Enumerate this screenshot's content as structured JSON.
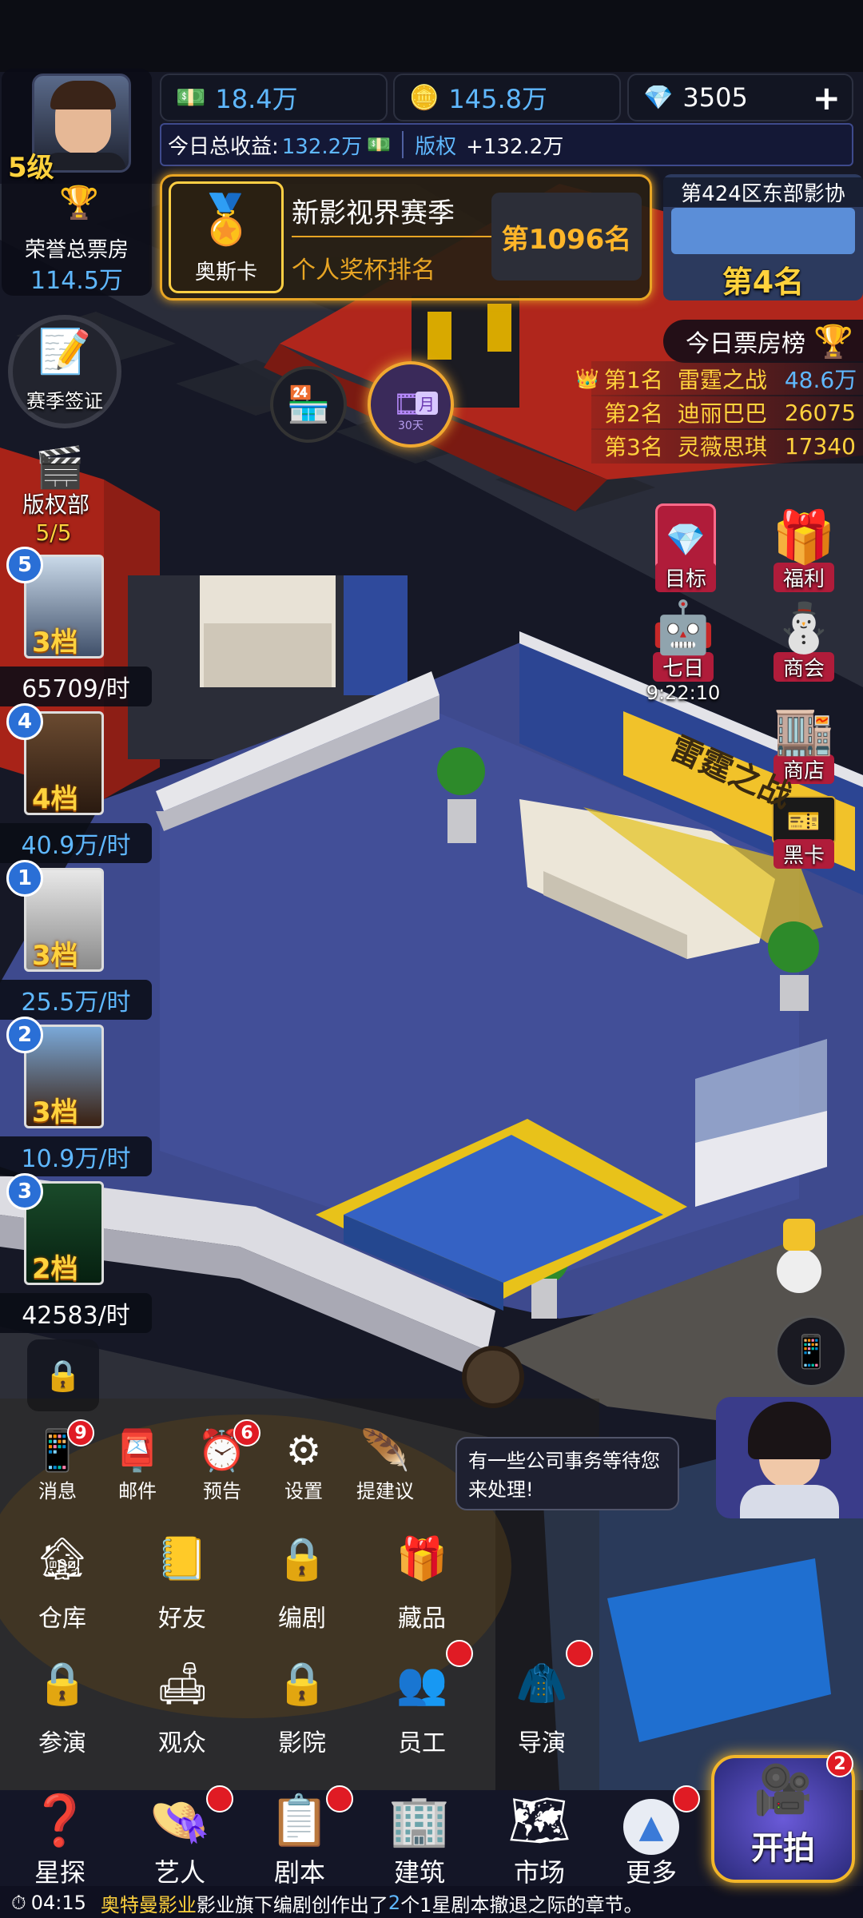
{
  "currency": {
    "cash": "18.4万",
    "gold": "145.8万",
    "diamonds": "3505",
    "plus": "+",
    "today_label": "今日总收益:",
    "today_value": "132.2万",
    "copyright_label": "版权",
    "copyright_value": "+132.2万"
  },
  "player": {
    "level": "5级",
    "honor_label": "荣誉总票房",
    "honor_value": "114.5万"
  },
  "season": {
    "card_label": "奥斯卡",
    "title": "新影视界赛季",
    "subtitle": "个人奖杯排名",
    "rank": "第1096名"
  },
  "region": {
    "name": "第424区东部影协",
    "rank": "第4名"
  },
  "boxoffice": {
    "title": "今日票房榜",
    "rows": [
      {
        "rank": "第1名",
        "name": "雷霆之战",
        "value": "48.6万"
      },
      {
        "rank": "第2名",
        "name": "迪丽巴巴",
        "value": "26075"
      },
      {
        "rank": "第3名",
        "name": "灵薇思琪",
        "value": "17340"
      }
    ]
  },
  "season_sign": "赛季签证",
  "monthly": {
    "label": "月",
    "days": "30天"
  },
  "copyright_dept": {
    "label": "版权部",
    "count": "5/5"
  },
  "movies": [
    {
      "badge": "5",
      "tier": "3档",
      "rate": "65709/时"
    },
    {
      "badge": "4",
      "tier": "4档",
      "rate": "40.9万/时"
    },
    {
      "badge": "1",
      "tier": "3档",
      "rate": "25.5万/时"
    },
    {
      "badge": "2",
      "tier": "3档",
      "rate": "10.9万/时"
    },
    {
      "badge": "3",
      "tier": "2档",
      "rate": "42583/时"
    }
  ],
  "right_buttons": {
    "goal": "目标",
    "welfare": "福利",
    "seven": "七日",
    "seven_timer": "9:22:10",
    "chamber": "商会",
    "shop": "商店",
    "black": "黑卡"
  },
  "room_sign": "雷霆之战",
  "small_menu": {
    "messages": "消息",
    "messages_badge": "9",
    "mail": "邮件",
    "preview": "预告",
    "preview_badge": "6",
    "settings": "设置",
    "suggest": "提建议"
  },
  "big_menu": {
    "warehouse": "仓库",
    "friends": "好友",
    "screenwriter": "编剧",
    "collection": "藏品",
    "cast": "参演",
    "audience": "观众",
    "cinema": "影院",
    "staff": "员工",
    "director": "导演"
  },
  "bubble": "有一些公司事务等待您来处理!",
  "nav": {
    "scout": "星探",
    "artist": "艺人",
    "script": "剧本",
    "building": "建筑",
    "market": "市场",
    "more": "更多",
    "shoot": "开拍",
    "shoot_badge": "2"
  },
  "ticker": {
    "time": "04:15",
    "company": "奥特曼影业",
    "text1": "影业旗下编剧创作出了",
    "count": "2",
    "text2": "个1星剧本撤退之际的章节。"
  },
  "colors": {
    "gold": "#ffd23d",
    "blue_text": "#5fb8ff",
    "red_dot": "#e01b24",
    "floor": "#3e4a8e"
  }
}
